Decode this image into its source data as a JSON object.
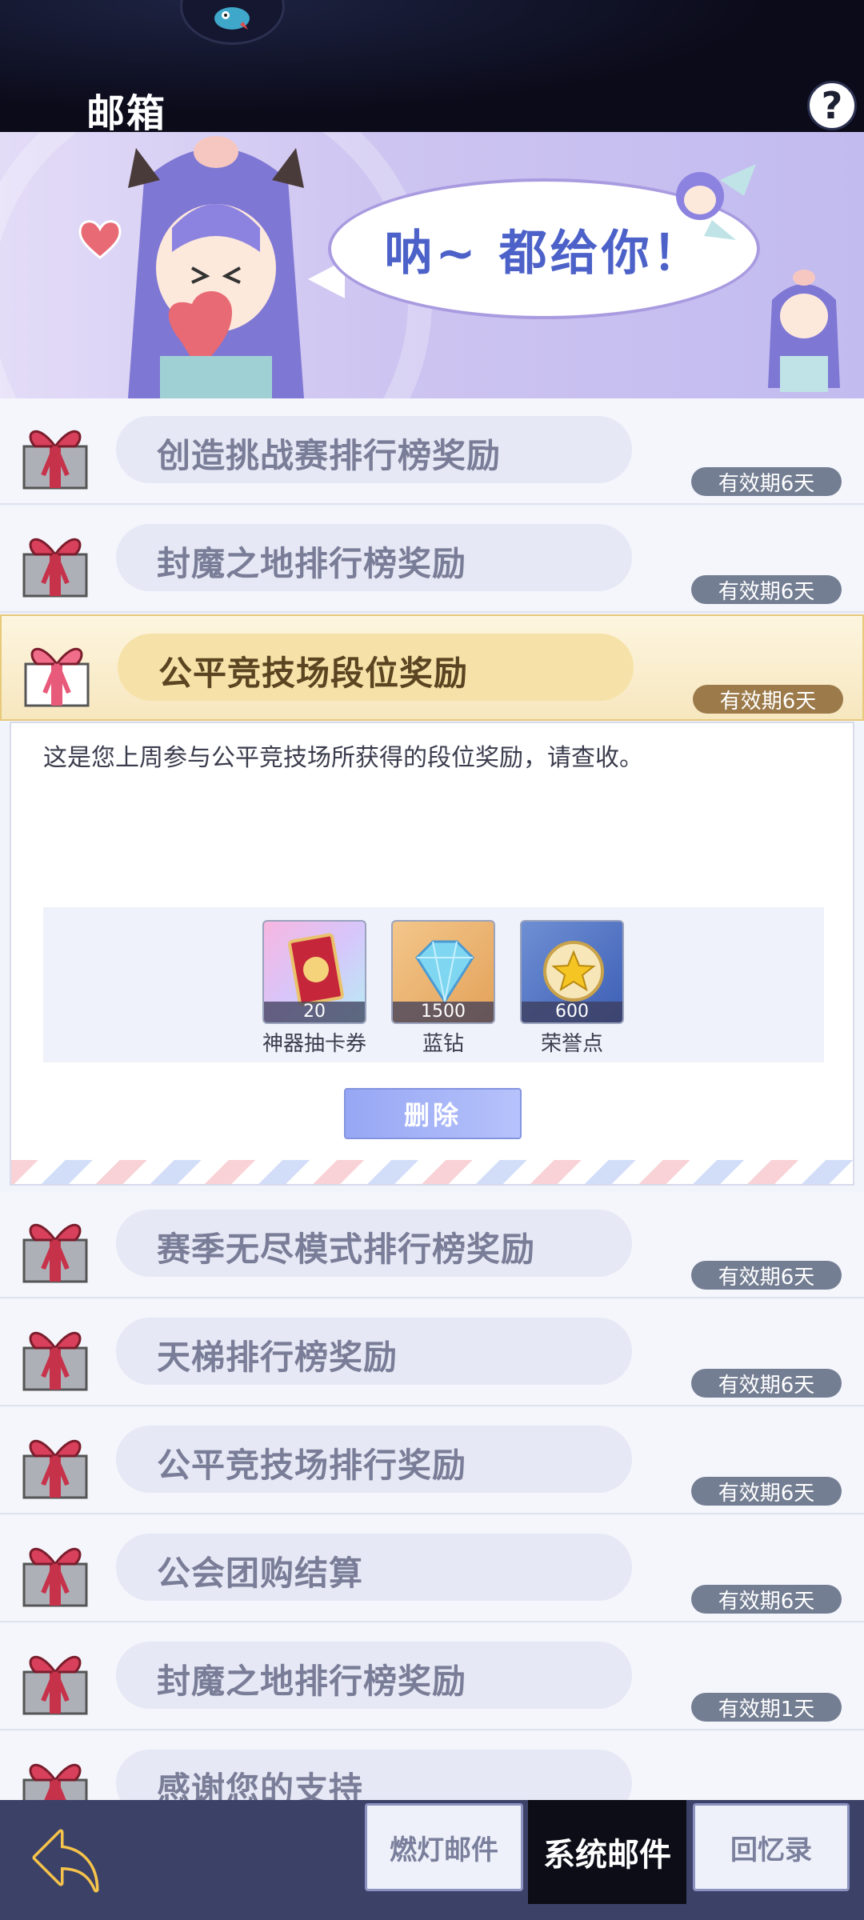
{
  "header": {
    "title": "邮箱",
    "help_label": "?"
  },
  "banner": {
    "speech": "呐~ 都给你！"
  },
  "mail_list": [
    {
      "subject": "创造挑战赛排行榜奖励",
      "expiry": "有效期6天",
      "selected": false
    },
    {
      "subject": "封魔之地排行榜奖励",
      "expiry": "有效期6天",
      "selected": false
    },
    {
      "subject": "公平竞技场段位奖励",
      "expiry": "有效期6天",
      "selected": true
    },
    {
      "subject": "赛季无尽模式排行榜奖励",
      "expiry": "有效期6天",
      "selected": false
    },
    {
      "subject": "天梯排行榜奖励",
      "expiry": "有效期6天",
      "selected": false
    },
    {
      "subject": "公平竞技场排行奖励",
      "expiry": "有效期6天",
      "selected": false
    },
    {
      "subject": "公会团购结算",
      "expiry": "有效期6天",
      "selected": false
    },
    {
      "subject": "封魔之地排行榜奖励",
      "expiry": "有效期1天",
      "selected": false
    },
    {
      "subject": "感谢您的支持",
      "expiry": "",
      "selected": false
    }
  ],
  "detail": {
    "body": "这是您上周参与公平竞技场所获得的段位奖励，请查收。",
    "rewards": [
      {
        "name": "神器抽卡券",
        "count": "20",
        "icon": "card-ticket-icon"
      },
      {
        "name": "蓝钻",
        "count": "1500",
        "icon": "blue-diamond-icon"
      },
      {
        "name": "荣誉点",
        "count": "600",
        "icon": "honor-star-icon"
      }
    ],
    "delete_label": "删除"
  },
  "tabs": [
    {
      "label": "燃灯邮件",
      "active": false
    },
    {
      "label": "系统邮件",
      "active": true
    },
    {
      "label": "回忆录",
      "active": false
    }
  ],
  "colors": {
    "accent": "#4d62c9",
    "selected_row": "#f7e7bf",
    "expiry_badge": "#747e93"
  }
}
